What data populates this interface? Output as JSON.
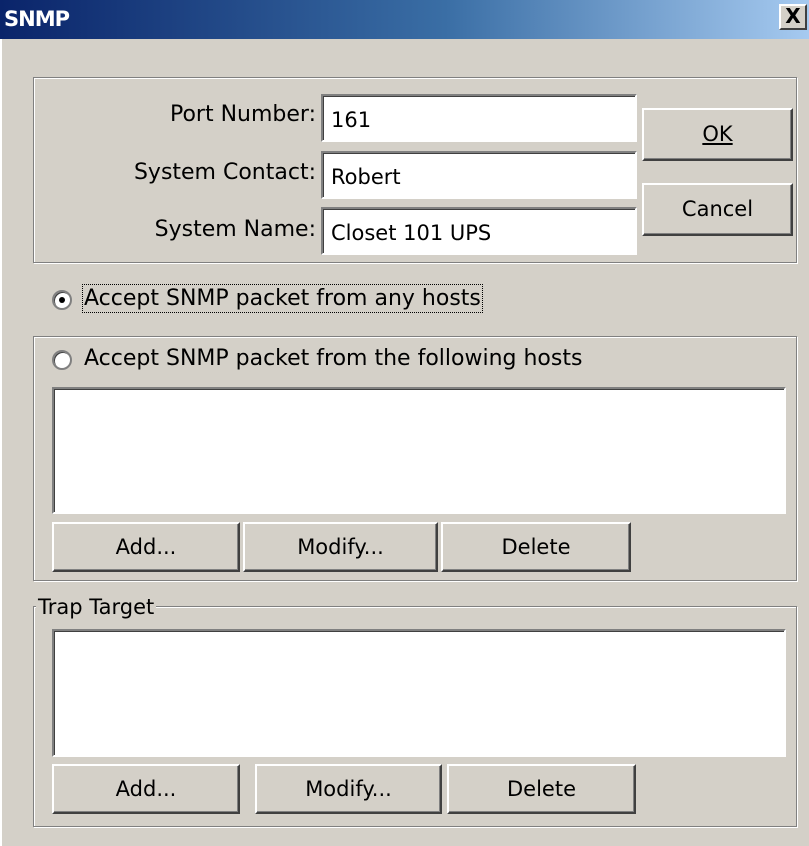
{
  "window": {
    "title": "SNMP",
    "close_label": "X"
  },
  "fields": [
    {
      "label": "Port Number:",
      "value": "161"
    },
    {
      "label": "System Contact:",
      "value": "Robert"
    },
    {
      "label": "System Name:",
      "value": "Closet 101 UPS"
    }
  ],
  "buttons": {
    "ok_label": "OK",
    "cancel_label": "Cancel"
  },
  "access": {
    "any_hosts_label": "Accept SNMP packet from any hosts",
    "following_hosts_label": "Accept SNMP packet from the following hosts",
    "selected": "any_hosts",
    "hosts": [],
    "add_label": "Add...",
    "modify_label": "Modify...",
    "delete_label": "Delete"
  },
  "trap": {
    "title": "Trap Target",
    "targets": [],
    "add_label": "Add...",
    "modify_label": "Modify...",
    "delete_label": "Delete"
  }
}
